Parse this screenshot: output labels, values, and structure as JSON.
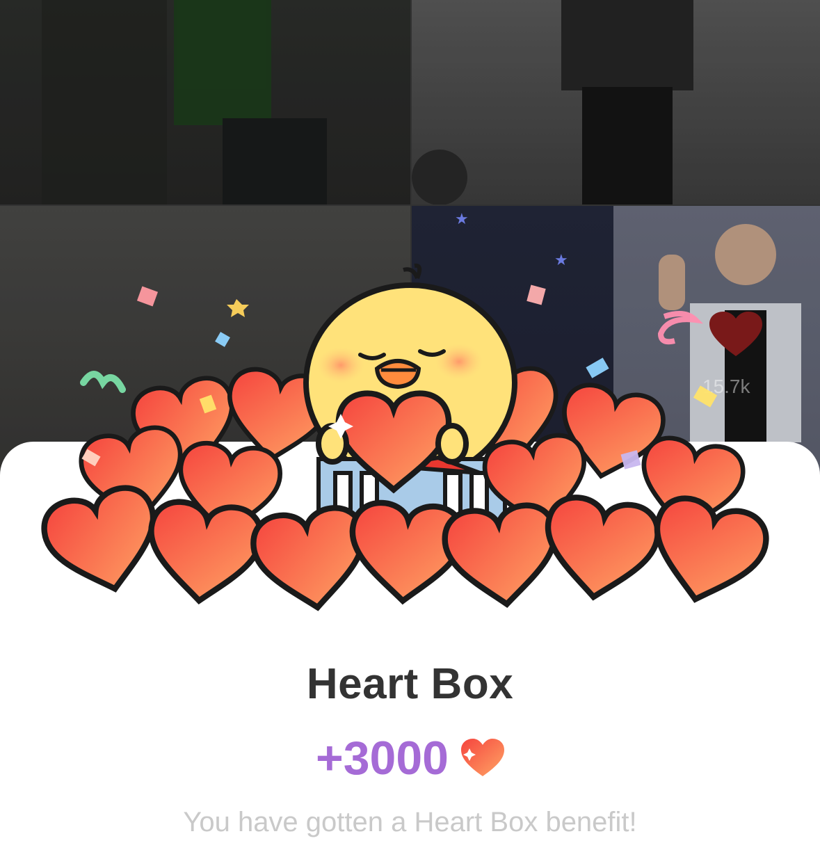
{
  "background": {
    "like_count": "15.7k"
  },
  "modal": {
    "title": "Heart Box",
    "reward_amount": "+3000",
    "reward_icon": "heart-icon",
    "description": "You have gotten a Heart Box benefit!"
  },
  "colors": {
    "accent_purple": "#a56bd6",
    "heart_red": "#f04a4a",
    "heart_orange": "#ffa060",
    "chick_yellow": "#ffe27a"
  }
}
